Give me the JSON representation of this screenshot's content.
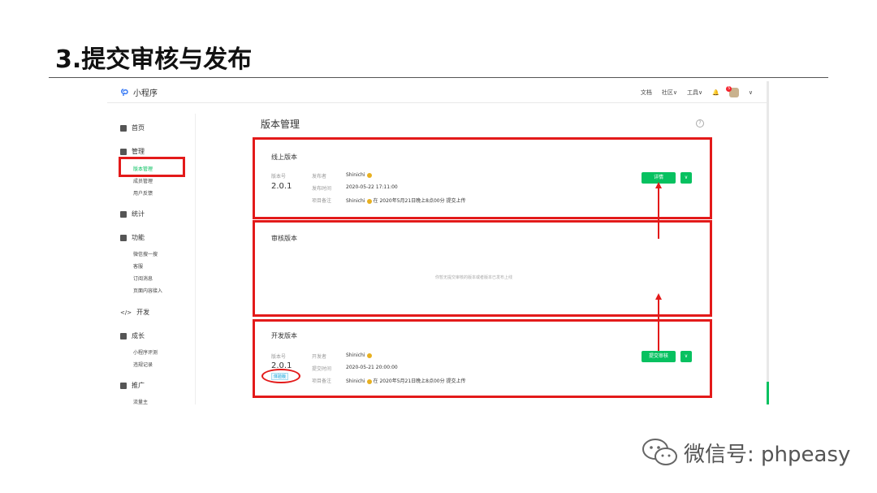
{
  "slide": {
    "title": "3.提交审核与发布"
  },
  "topbar": {
    "app_name": "小程序",
    "nav": [
      "文档",
      "社区∨",
      "工具∨"
    ],
    "notification_count": "5"
  },
  "sidebar": {
    "home": "首页",
    "manage": "管理",
    "manage_items": [
      "版本管理",
      "成员管理",
      "用户反馈"
    ],
    "stats": "统计",
    "features": "功能",
    "feature_items": [
      "微信搜一搜",
      "客服",
      "订阅消息",
      "页面内容接入"
    ],
    "dev": "开发",
    "growth": "成长",
    "growth_items": [
      "小程序评测",
      "违规记录"
    ],
    "promo": "推广",
    "promo_items": [
      "流量主"
    ]
  },
  "main": {
    "title": "版本管理",
    "online": {
      "title": "线上版本",
      "version_label": "版本号",
      "version": "2.0.1",
      "publisher_label": "发布者",
      "publisher": "Shinichi",
      "time_label": "发布时间",
      "time": "2020-05-22 17:11:00",
      "note_label": "项目备注",
      "note_user": "Shinichi",
      "note": "在 2020年5月21日晚上8点00分 提交上传",
      "button": "详情"
    },
    "review": {
      "title": "审核版本",
      "empty": "你暂无提交审核的版本或者版本已发布上线"
    },
    "dev": {
      "title": "开发版本",
      "version_label": "版本号",
      "version": "2.0.1",
      "badge": "体验版",
      "developer_label": "开发者",
      "developer": "Shinichi",
      "time_label": "提交时间",
      "time": "2020-05-21 20:00:00",
      "note_label": "项目备注",
      "note_user": "Shinichi",
      "note": "在 2020年5月21日晚上8点00分 提交上传",
      "button": "提交审核"
    }
  },
  "watermark": {
    "text": "微信号: phpeasy"
  },
  "colors": {
    "accent": "#07c160",
    "highlight": "#e31a1a"
  }
}
